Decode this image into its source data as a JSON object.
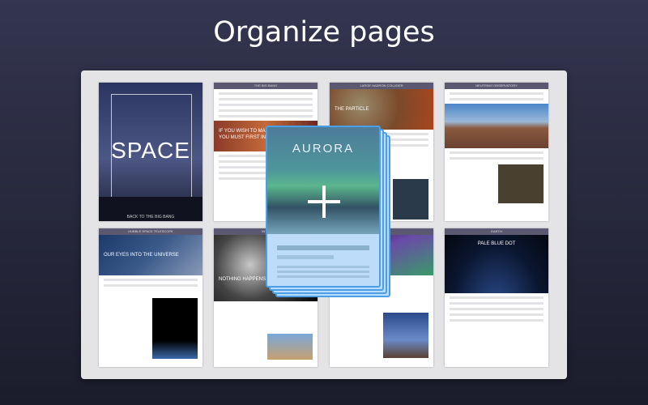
{
  "title": "Organize pages",
  "pages": {
    "space": {
      "title": "SPACE",
      "subtitle": "BACK TO THE BIG BANG"
    },
    "big_bang": {
      "header": "THE BIG BANG",
      "quote1": "IF YOU WISH TO MAKE AN",
      "quote2": "YOU MUST FIRST INVENT"
    },
    "collider": {
      "header": "LARGE HADRON COLLIDER",
      "caption": "THE PARTICLE"
    },
    "neutrino": {
      "header": "NEUTRINO OBSERVATORY"
    },
    "hubble": {
      "header": "HUBBLE SPACE TELESCOPE",
      "caption": "OUR EYES INTO THE UNIVERSE"
    },
    "into": {
      "header": "INTO",
      "quote": "NOTHING HAPPENS UNTIL"
    },
    "earth": {
      "header": "EARTH",
      "caption": "PALE BLUE DOT"
    }
  },
  "dragged": {
    "title": "AURORA",
    "icon": "plus-icon"
  }
}
